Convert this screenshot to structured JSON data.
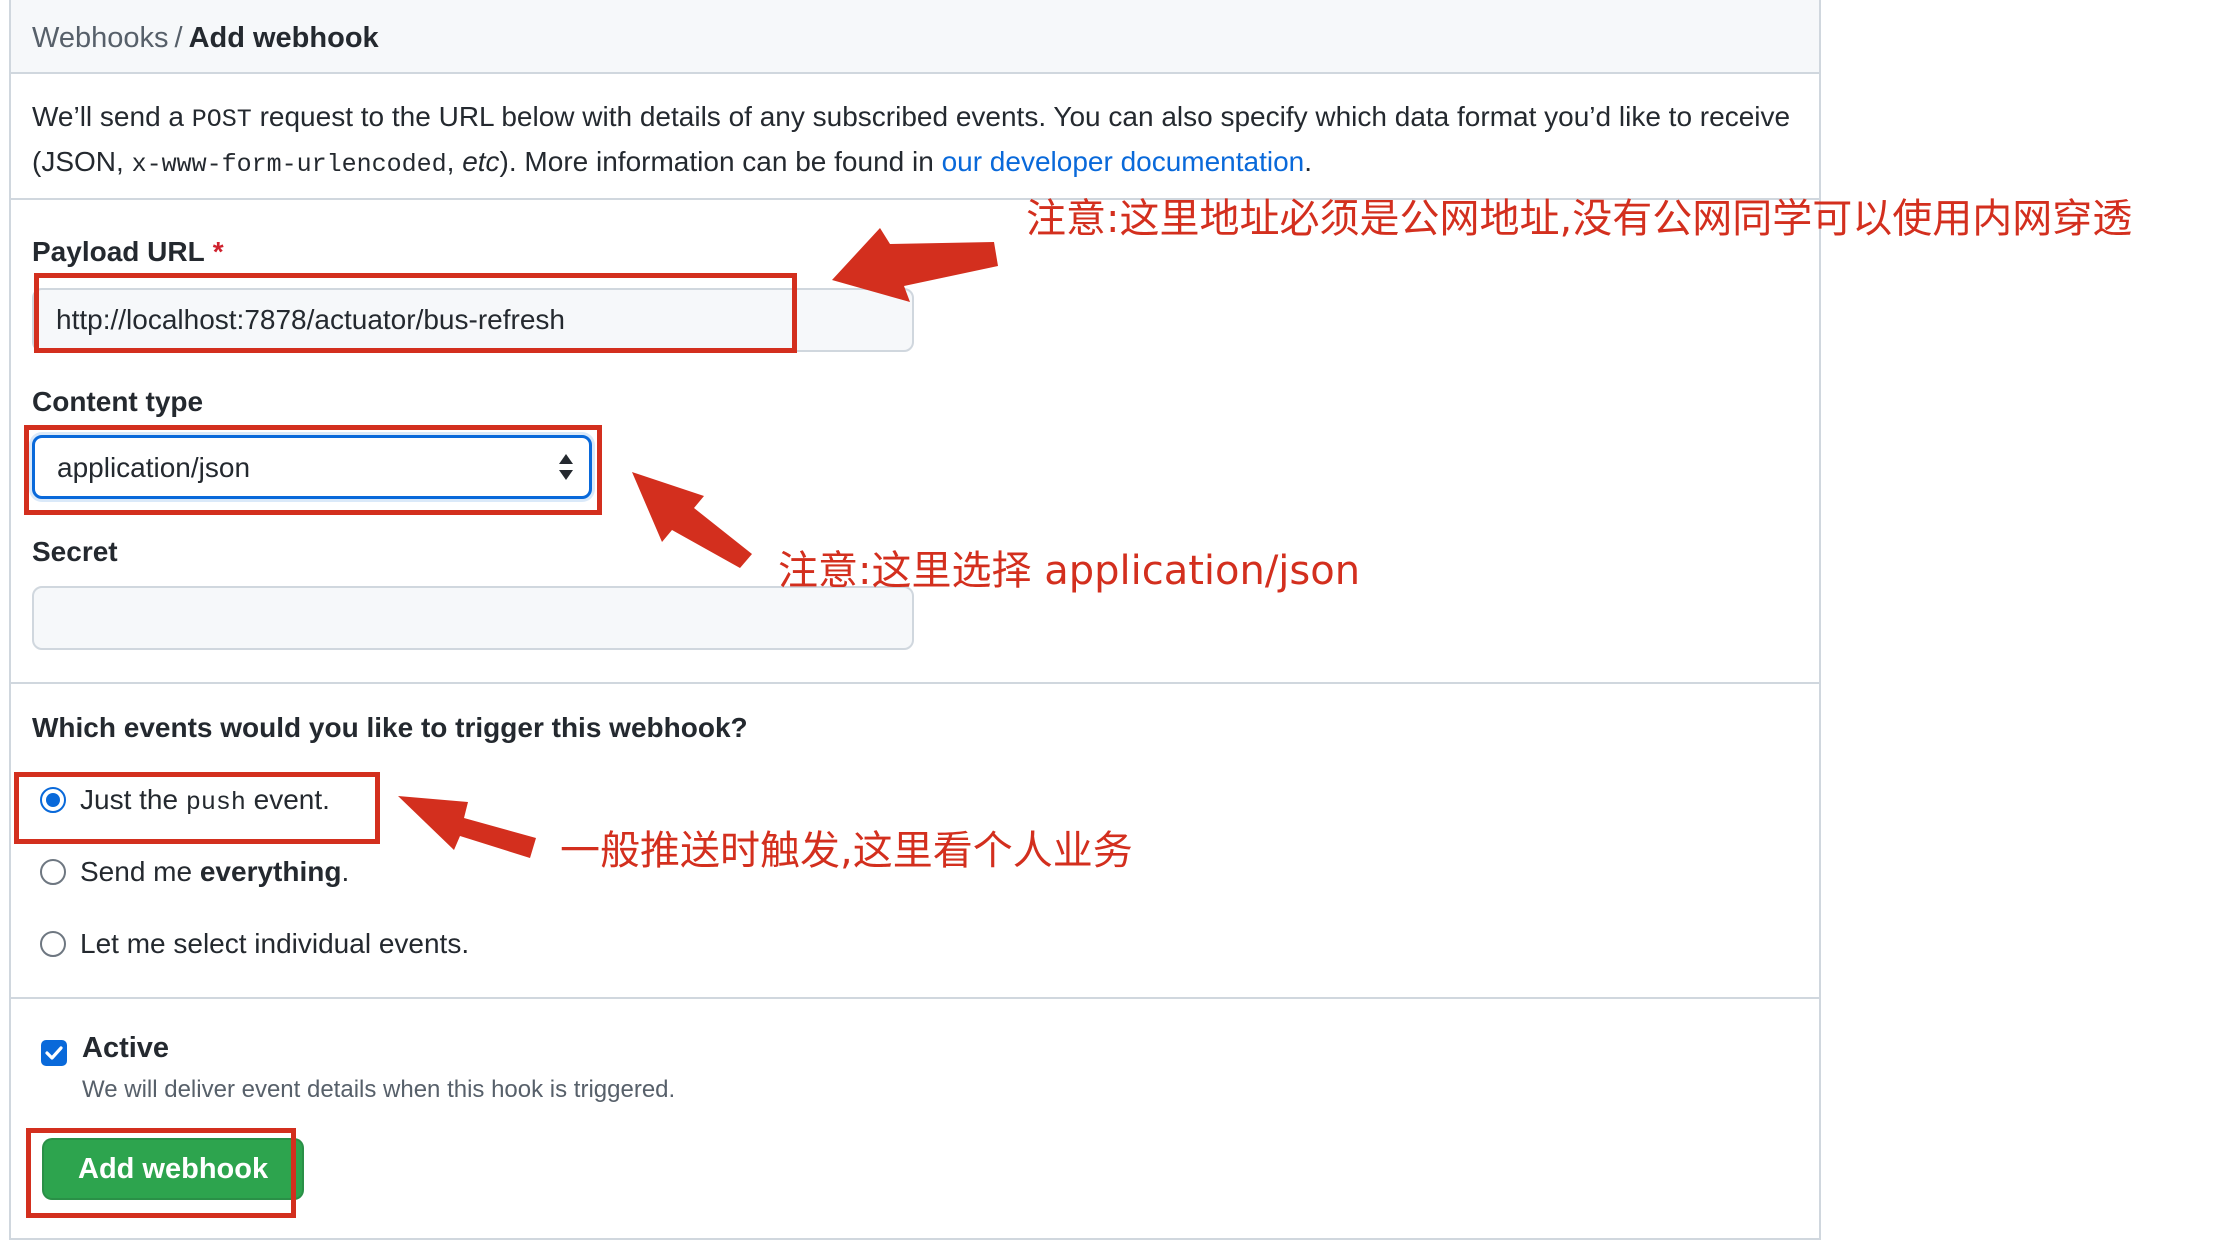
{
  "breadcrumb": {
    "parent": "Webhooks",
    "separator": "/",
    "current": "Add webhook"
  },
  "intro": {
    "text_1": "We’ll send a ",
    "code_1": "POST",
    "text_2": " request to the URL below with details of any subscribed events. You can also specify which data format you’d like to receive (JSON, ",
    "code_2": "x-www-form-urlencoded",
    "text_3": ", ",
    "italic": "etc",
    "text_4": "). More information can be found in ",
    "link": "our developer documentation",
    "text_5": "."
  },
  "form": {
    "payload_url": {
      "label": "Payload URL",
      "required_mark": "*",
      "value": "http://localhost:7878/actuator/bus-refresh"
    },
    "content_type": {
      "label": "Content type",
      "selected": "application/json"
    },
    "secret": {
      "label": "Secret",
      "value": ""
    },
    "events": {
      "question": "Which events would you like to trigger this webhook?",
      "options": [
        {
          "pre": "Just the ",
          "code": "push",
          "post": " event.",
          "checked": true
        },
        {
          "pre": "Send me ",
          "bold": "everything",
          "post": ".",
          "checked": false
        },
        {
          "pre": "Let me select individual events.",
          "checked": false
        }
      ]
    },
    "active": {
      "label": "Active",
      "help": "We will deliver event details when this hook is triggered.",
      "checked": true
    },
    "submit_label": "Add webhook"
  },
  "annotations": {
    "note_url": "注意:这里地址必须是公网地址,没有公网同学可以使用内网穿透",
    "note_content_type": "注意:这里选择 application/json",
    "note_events": "一般推送时触发,这里看个人业务",
    "color": "#d32f1e"
  },
  "colors": {
    "link": "#0969da",
    "primary_button": "#2da44e",
    "border": "#d0d7de",
    "header_bg": "#f6f8fa"
  }
}
